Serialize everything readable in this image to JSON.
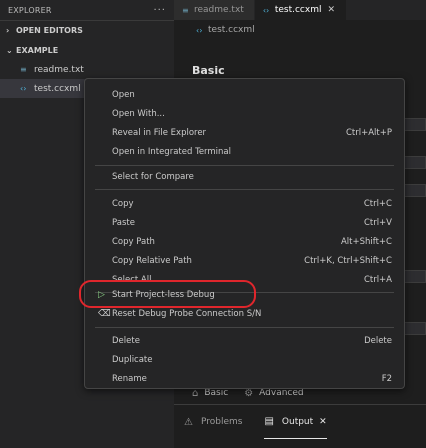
{
  "sidebar": {
    "title": "EXPLORER",
    "more_icon": "ellipsis-icon",
    "open_editors": "OPEN EDITORS",
    "folder": "EXAMPLE",
    "files": [
      {
        "name": "readme.txt",
        "icon": "text-file-icon"
      },
      {
        "name": "test.ccxml",
        "icon": "xml-file-icon"
      }
    ]
  },
  "tabs": [
    {
      "label": "readme.txt"
    },
    {
      "label": "test.ccxml",
      "close": "✕"
    }
  ],
  "breadcrumb": {
    "file": "test.ccxml"
  },
  "editor": {
    "title": "Basic"
  },
  "bottom_tabs": [
    {
      "label": "Basic",
      "icon": "home-icon"
    },
    {
      "label": "Advanced",
      "icon": "gear-icon"
    }
  ],
  "panel": {
    "tabs": [
      {
        "label": "Problems",
        "icon": "warning-icon"
      },
      {
        "label": "Output",
        "icon": "output-icon",
        "close": "✕"
      }
    ]
  },
  "context_menu": {
    "groups": [
      [
        {
          "label": "Open",
          "shortcut": ""
        },
        {
          "label": "Open With...",
          "shortcut": ""
        },
        {
          "label": "Reveal in File Explorer",
          "shortcut": "Ctrl+Alt+P"
        },
        {
          "label": "Open in Integrated Terminal",
          "shortcut": ""
        }
      ],
      [
        {
          "label": "Select for Compare",
          "shortcut": ""
        }
      ],
      [
        {
          "label": "Copy",
          "shortcut": "Ctrl+C"
        },
        {
          "label": "Paste",
          "shortcut": "Ctrl+V"
        },
        {
          "label": "Copy Path",
          "shortcut": "Alt+Shift+C"
        },
        {
          "label": "Copy Relative Path",
          "shortcut": "Ctrl+K, Ctrl+Shift+C"
        },
        {
          "label": "Select All",
          "shortcut": "Ctrl+A"
        }
      ],
      [
        {
          "label": "Start Project-less Debug",
          "shortcut": "",
          "icon": "debug-icon"
        },
        {
          "label": "Reset Debug Probe Connection S/N",
          "shortcut": "",
          "icon": "eraser-icon"
        }
      ],
      [
        {
          "label": "Delete",
          "shortcut": "Delete"
        },
        {
          "label": "Duplicate",
          "shortcut": ""
        },
        {
          "label": "Rename",
          "shortcut": "F2"
        }
      ]
    ]
  },
  "colors": {
    "annotation": "#e0262c",
    "menu_bg": "#252526",
    "editor_bg": "#1e1e1e"
  }
}
